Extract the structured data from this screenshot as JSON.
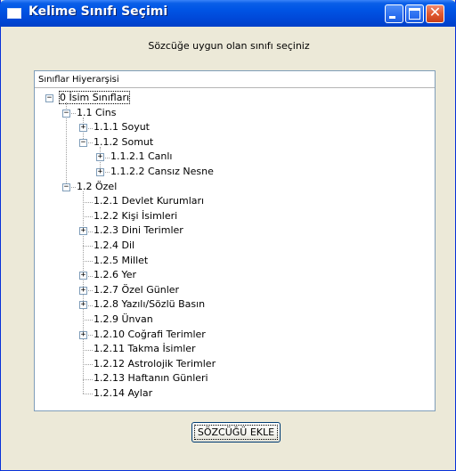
{
  "window": {
    "title": "Kelime Sınıfı Seçimi"
  },
  "instruction": "Sözcüğe uygun olan sınıfı seçiniz",
  "tree": {
    "header": "Sınıflar Hiyerarşisi",
    "nodes": [
      {
        "label": "0 İsim Sınıfları",
        "state": "expanded"
      },
      {
        "label": "1.1 Cins",
        "state": "expanded"
      },
      {
        "label": "1.1.1 Soyut",
        "state": "collapsed"
      },
      {
        "label": "1.1.2 Somut",
        "state": "expanded"
      },
      {
        "label": "1.1.2.1 Canlı",
        "state": "collapsed"
      },
      {
        "label": "1.1.2.2 Cansız Nesne",
        "state": "collapsed"
      },
      {
        "label": "1.2 Özel",
        "state": "expanded"
      },
      {
        "label": "1.2.1 Devlet Kurumları",
        "state": "leaf"
      },
      {
        "label": "1.2.2 Kişi İsimleri",
        "state": "leaf"
      },
      {
        "label": "1.2.3 Dini Terimler",
        "state": "collapsed"
      },
      {
        "label": "1.2.4 Dil",
        "state": "leaf"
      },
      {
        "label": "1.2.5 Millet",
        "state": "leaf"
      },
      {
        "label": "1.2.6 Yer",
        "state": "collapsed"
      },
      {
        "label": "1.2.7 Özel Günler",
        "state": "collapsed"
      },
      {
        "label": "1.2.8 Yazılı/Sözlü Basın",
        "state": "collapsed"
      },
      {
        "label": "1.2.9 Ünvan",
        "state": "leaf"
      },
      {
        "label": "1.2.10 Coğrafi Terimler",
        "state": "collapsed"
      },
      {
        "label": "1.2.11 Takma İsimler",
        "state": "leaf"
      },
      {
        "label": "1.2.12 Astrolojik Terimler",
        "state": "leaf"
      },
      {
        "label": "1.2.13 Haftanın Günleri",
        "state": "leaf"
      },
      {
        "label": "1.2.14 Aylar",
        "state": "leaf"
      }
    ]
  },
  "buttons": {
    "add_word": "SÖZCÜĞÜ EKLE"
  },
  "icons": {
    "app": "window-icon",
    "minimize": "minimize-icon",
    "maximize": "maximize-icon",
    "close": "close-icon",
    "expanded": "minus-box-icon",
    "collapsed": "plus-box-icon"
  },
  "colors": {
    "titlebar": "#0055e5",
    "window_bg": "#ece9d8",
    "close_button": "#e15a30"
  }
}
